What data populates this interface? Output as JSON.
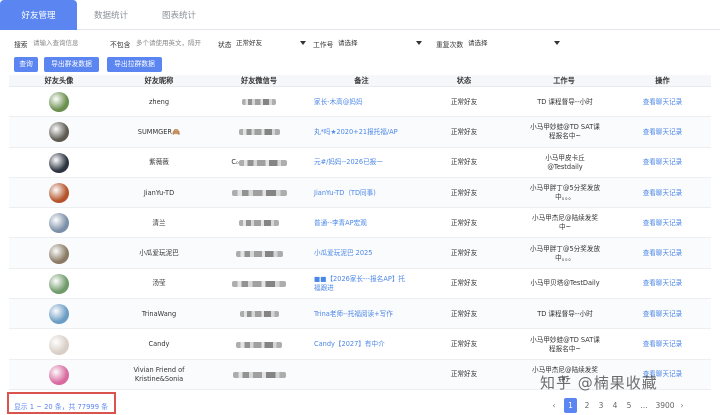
{
  "tabs": [
    "好友管理",
    "数据统计",
    "图表统计"
  ],
  "filters": {
    "search_label": "搜索",
    "search_placeholder": "请输入查询信息",
    "exclude_label": "不包含",
    "exclude_placeholder": "多个请使用英文，隔开",
    "status_label": "状态",
    "status_value": "正常好友",
    "job_label": "工作号",
    "job_value": "请选择",
    "repeat_label": "重复次数",
    "repeat_value": "请选择"
  },
  "buttons": {
    "query": "查询",
    "export_group": "导出群发数据",
    "export_pull": "导出拉群数据"
  },
  "columns": [
    "好友头像",
    "好友昵称",
    "好友微信号",
    "备注",
    "状态",
    "工作号",
    "操作"
  ],
  "rows": [
    {
      "nickname": "zheng",
      "wechat": "",
      "remark": "家长-木高@妈妈",
      "status": "正常好友",
      "job": "TD 课程督导--小时",
      "action": "查看聊天记录",
      "avatar": "#6a8f4e"
    },
    {
      "nickname": "SUMMGER🙈",
      "wechat": "",
      "remark": "丸*吗★2020+21报托福/AP",
      "status": "正常好友",
      "job": "小马甲妙蛙@TD SAT课程报名中~",
      "action": "查看聊天记录",
      "avatar": "#5e5a52"
    },
    {
      "nickname": "紫薇薇",
      "wechat": "C₀",
      "remark": "元#/妈妈--2026已报一",
      "status": "正常好友",
      "job": "小马甲皮卡丘@Testdaily",
      "action": "查看聊天记录",
      "avatar": "#2d3440"
    },
    {
      "nickname": "JianYu-TD",
      "wechat": "",
      "remark": "JianYu-TD（TD同事)",
      "status": "正常好友",
      "job": "小马甲胖丁@5分奖发放中。。。",
      "action": "查看聊天记录",
      "avatar": "#b5542a"
    },
    {
      "nickname": "清兰",
      "wechat": "",
      "remark": "普通--李青AP宏观",
      "status": "正常好友",
      "job": "小马甲杰尼@陆续发奖中~",
      "action": "查看聊天记录",
      "avatar": "#7c8fa8"
    },
    {
      "nickname": "小瓜爱玩泥巴",
      "wechat": "",
      "remark": "小瓜爱玩泥巴 2025",
      "status": "正常好友",
      "job": "小马甲胖丁@5分奖发放中。。。",
      "action": "查看聊天记录",
      "avatar": "#8a7a64"
    },
    {
      "nickname": "汤莹",
      "wechat": "",
      "remark": "■■【2026家长---报名AP】托福跟进",
      "status": "正常好友",
      "job": "小马甲贝塔@TestDaily",
      "action": "查看聊天记录",
      "avatar": "#6f9a6a"
    },
    {
      "nickname": "TrinaWang",
      "wechat": "",
      "remark": "Trina老师--托福阅读+写作",
      "status": "正常好友",
      "job": "TD 课程督导--小时",
      "action": "查看聊天记录",
      "avatar": "#6a9cc4"
    },
    {
      "nickname": "Candy",
      "wechat": "",
      "remark": "Candy【2027】有中介",
      "status": "正常好友",
      "job": "小马甲妙蛙@TD SAT课程报名中~",
      "action": "查看聊天记录",
      "avatar": "#d8cfc6"
    },
    {
      "nickname": "Vivian Friend of Kristine&Sonia",
      "wechat": "",
      "remark": "",
      "status": "正常好友",
      "job": "小马甲杰尼@陆续发奖中~",
      "action": "查看聊天记录",
      "avatar": "#d96aa0"
    }
  ],
  "footer": {
    "summary": "显示 1 ~ 20 条，共 77999 条"
  },
  "pagination": {
    "pages": [
      "1",
      "2",
      "3",
      "4",
      "5",
      "...",
      "3900"
    ],
    "prev": "‹",
    "next": "›"
  },
  "watermark": "知乎 @楠果收藏",
  "colors": {
    "accent": "#5b85f0",
    "link": "#4a86e8",
    "highlight_border": "#d9534f"
  }
}
